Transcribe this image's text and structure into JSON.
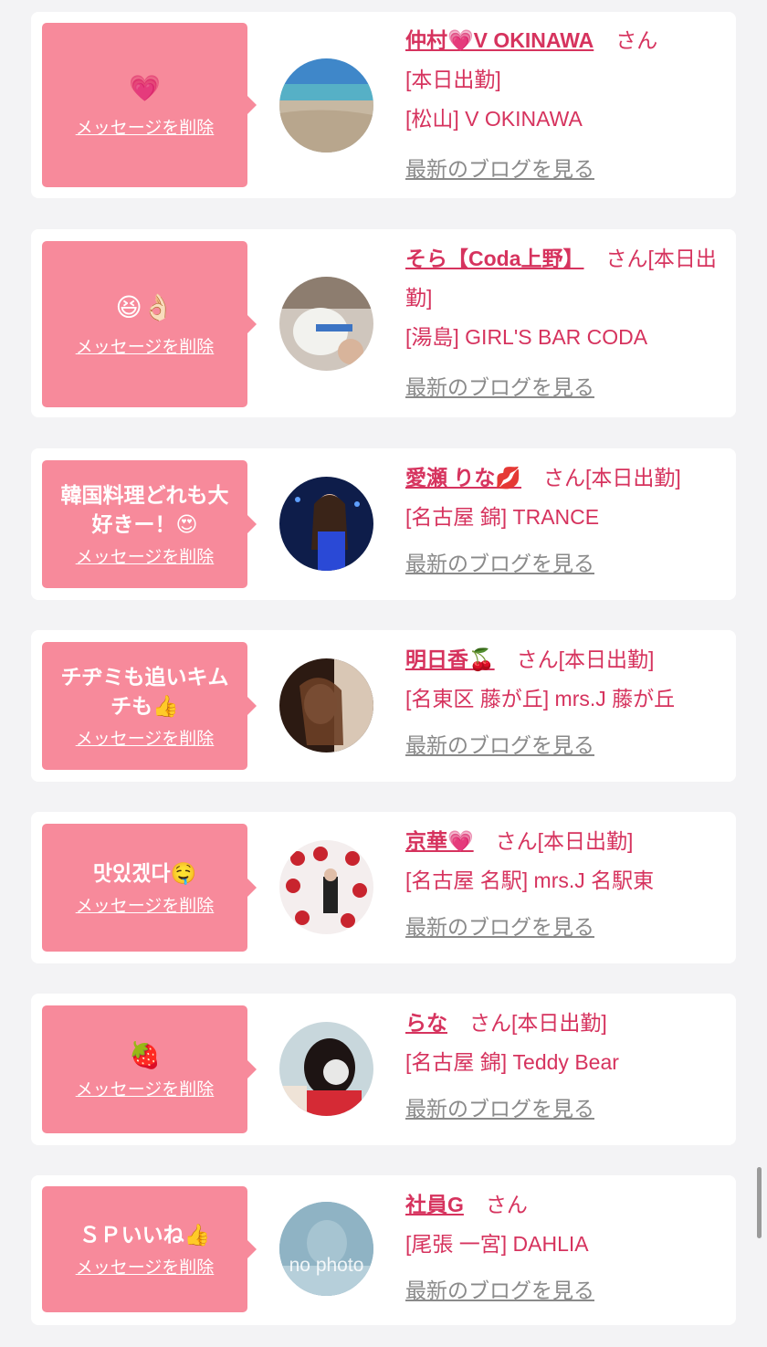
{
  "items": [
    {
      "message": "💗",
      "delete_label": "メッセージを削除",
      "name": "仲村💗V OKINAWA",
      "suffix": "さん",
      "status": "[本日出勤]",
      "shop": "[松山] V OKINAWA",
      "blog_label": "最新のブログを見る",
      "avatar_icon": "beach-photo"
    },
    {
      "message": "😆👌🏻",
      "delete_label": "メッセージを削除",
      "name": "そら【Coda上野】",
      "suffix": "さん[本日出勤]",
      "status": "",
      "shop": "[湯島] GIRL'S BAR CODA",
      "blog_label": "最新のブログを見る",
      "avatar_icon": "plush-photo"
    },
    {
      "message": "韓国料理どれも大好きー！😍",
      "delete_label": "メッセージを削除",
      "name": "愛瀬 りな💋",
      "suffix": "さん[本日出勤]",
      "status": "",
      "shop": "[名古屋 錦] TRANCE",
      "blog_label": "最新のブログを見る",
      "avatar_icon": "portrait-photo"
    },
    {
      "message": "チヂミも追いキムチも👍",
      "delete_label": "メッセージを削除",
      "name": "明日香🍒",
      "suffix": "さん[本日出勤]",
      "status": "",
      "shop": "[名東区 藤が丘] mrs.J 藤が丘",
      "blog_label": "最新のブログを見る",
      "avatar_icon": "portrait-photo"
    },
    {
      "message": "맛있겠다🤤",
      "delete_label": "メッセージを削除",
      "name": "京華💗",
      "suffix": "さん[本日出勤]",
      "status": "",
      "shop": "[名古屋 名駅] mrs.J 名駅東",
      "blog_label": "最新のブログを見る",
      "avatar_icon": "cherry-photo"
    },
    {
      "message": "🍓",
      "delete_label": "メッセージを削除",
      "name": "らな",
      "suffix": "さん[本日出勤]",
      "status": "",
      "shop": "[名古屋 錦] Teddy Bear",
      "blog_label": "最新のブログを見る",
      "avatar_icon": "portrait-photo"
    },
    {
      "message": "ＳＰいいね👍",
      "delete_label": "メッセージを削除",
      "name": "社員G",
      "suffix": "さん",
      "status": "",
      "shop": "[尾張 一宮] DAHLIA",
      "blog_label": "最新のブログを見る",
      "avatar_icon": "no-photo",
      "avatar_text": "no photo"
    }
  ],
  "colors": {
    "accent": "#d6335e",
    "bubble": "#f78a9b",
    "muted": "#8a8a8a"
  }
}
